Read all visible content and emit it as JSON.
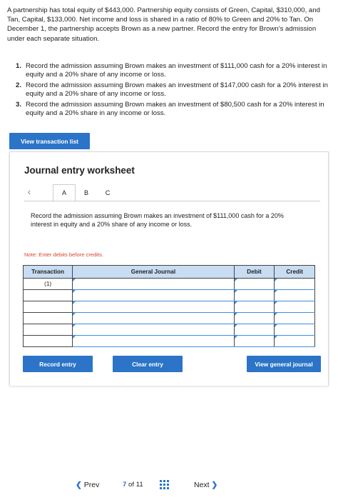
{
  "problem_text": "A partnership has total equity of $443,000. Partnership equity consists of Green, Capital, $310,000, and Tan, Capital, $133,000. Net income and loss is shared in a ratio of 80% to Green and 20% to Tan. On December 1, the partnership accepts Brown as a new partner. Record the entry for Brown's admission under each separate situation.",
  "steps": [
    {
      "num": "1.",
      "text": "Record the admission assuming Brown makes an investment of $111,000 cash for a 20% interest in equity and a 20% share of any income or loss."
    },
    {
      "num": "2.",
      "text": "Record the admission assuming Brown makes an investment of $147,000 cash for a 20% interest in equity and a 20% share of any income or loss."
    },
    {
      "num": "3.",
      "text": "Record the admission assuming Brown makes an investment of $80,500 cash for a 20% interest in equity and a 20% share in any income or loss."
    }
  ],
  "view_transaction_label": "View transaction list",
  "worksheet": {
    "title": "Journal entry worksheet",
    "tabs": [
      "A",
      "B",
      "C"
    ],
    "instruction": "Record the admission assuming Brown makes an investment of $111,000 cash for a 20% interest in equity and a 20% share of any income or loss.",
    "note": "Note: Enter debits before credits.",
    "columns": [
      "Transaction",
      "General Journal",
      "Debit",
      "Credit"
    ],
    "rows": [
      {
        "transaction": "(1)"
      },
      {
        "transaction": ""
      },
      {
        "transaction": ""
      },
      {
        "transaction": ""
      },
      {
        "transaction": ""
      },
      {
        "transaction": ""
      }
    ],
    "record_entry_label": "Record entry",
    "clear_entry_label": "Clear entry",
    "view_general_journal_label": "View general journal"
  },
  "pagination": {
    "prev_label": "Prev",
    "current": "7",
    "of_label": "of",
    "total": "11",
    "next_label": "Next"
  },
  "colors": {
    "accent": "#2b74c8",
    "note": "#d6452b",
    "table_header": "#c8dcf2"
  }
}
